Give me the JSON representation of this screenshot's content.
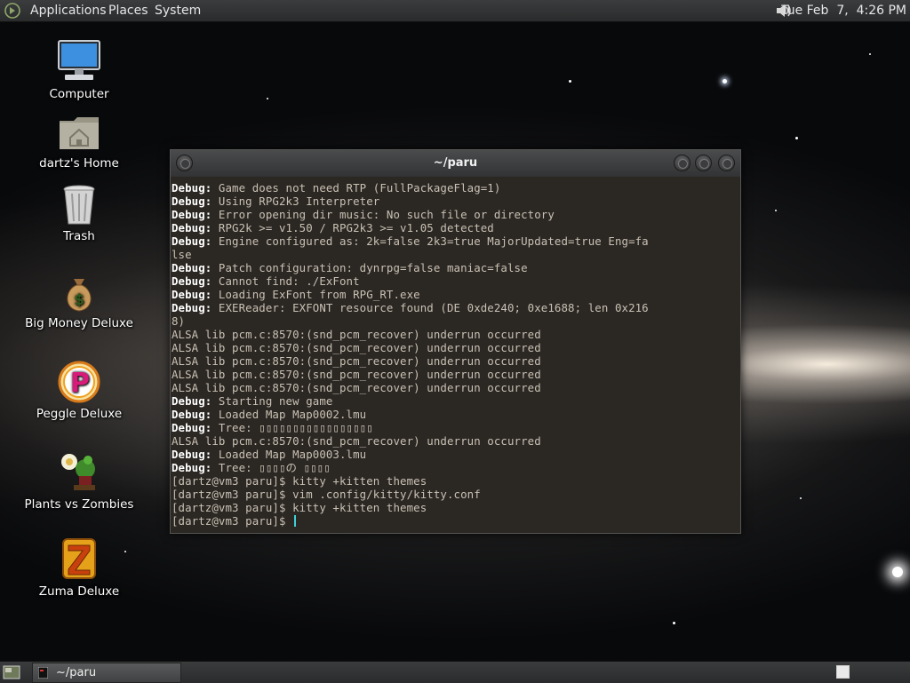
{
  "top_panel": {
    "menus": [
      "Applications",
      "Places",
      "System"
    ],
    "clock": "Tue Feb  7,  4:26 PM"
  },
  "desktop_icons": [
    {
      "label": "Computer",
      "icon": "computer-icon"
    },
    {
      "label": "dartz's Home",
      "icon": "home-folder-icon"
    },
    {
      "label": "Trash",
      "icon": "trash-icon"
    },
    {
      "label": "Big Money Deluxe",
      "icon": "money-bag-icon"
    },
    {
      "label": "Peggle Deluxe",
      "icon": "peggle-icon"
    },
    {
      "label": "Plants vs Zombies",
      "icon": "plants-vs-zombies-icon"
    },
    {
      "label": "Zuma Deluxe",
      "icon": "zuma-icon"
    }
  ],
  "terminal": {
    "title": "~/paru",
    "lines": [
      {
        "prefix": "Debug:",
        "text": " Game does not need RTP (FullPackageFlag=1)"
      },
      {
        "prefix": "Debug:",
        "text": " Using RPG2k3 Interpreter"
      },
      {
        "prefix": "Debug:",
        "text": " Error opening dir music: No such file or directory"
      },
      {
        "prefix": "Debug:",
        "text": " RPG2k >= v1.50 / RPG2k3 >= v1.05 detected"
      },
      {
        "prefix": "Debug:",
        "text": " Engine configured as: 2k=false 2k3=true MajorUpdated=true Eng=fa"
      },
      {
        "prefix": "",
        "text": "lse"
      },
      {
        "prefix": "Debug:",
        "text": " Patch configuration: dynrpg=false maniac=false"
      },
      {
        "prefix": "Debug:",
        "text": " Cannot find: ./ExFont"
      },
      {
        "prefix": "Debug:",
        "text": " Loading ExFont from RPG_RT.exe"
      },
      {
        "prefix": "Debug:",
        "text": " EXEReader: EXFONT resource found (DE 0xde240; 0xe1688; len 0x216"
      },
      {
        "prefix": "",
        "text": "8)"
      },
      {
        "prefix": "",
        "text": "ALSA lib pcm.c:8570:(snd_pcm_recover) underrun occurred"
      },
      {
        "prefix": "",
        "text": "ALSA lib pcm.c:8570:(snd_pcm_recover) underrun occurred"
      },
      {
        "prefix": "",
        "text": "ALSA lib pcm.c:8570:(snd_pcm_recover) underrun occurred"
      },
      {
        "prefix": "",
        "text": "ALSA lib pcm.c:8570:(snd_pcm_recover) underrun occurred"
      },
      {
        "prefix": "",
        "text": "ALSA lib pcm.c:8570:(snd_pcm_recover) underrun occurred"
      },
      {
        "prefix": "Debug:",
        "text": " Starting new game"
      },
      {
        "prefix": "Debug:",
        "text": " Loaded Map Map0002.lmu"
      },
      {
        "prefix": "Debug:",
        "text": " Tree: ▯▯▯▯▯▯▯▯▯▯▯▯▯▯▯▯▯"
      },
      {
        "prefix": "",
        "text": "ALSA lib pcm.c:8570:(snd_pcm_recover) underrun occurred"
      },
      {
        "prefix": "Debug:",
        "text": " Loaded Map Map0003.lmu"
      },
      {
        "prefix": "Debug:",
        "text": " Tree: ▯▯▯▯の ▯▯▯▯"
      },
      {
        "prefix": "",
        "text": "[dartz@vm3 paru]$ kitty +kitten themes"
      },
      {
        "prefix": "",
        "text": "[dartz@vm3 paru]$ vim .config/kitty/kitty.conf"
      },
      {
        "prefix": "",
        "text": "[dartz@vm3 paru]$ kitty +kitten themes"
      }
    ],
    "prompt": "[dartz@vm3 paru]$ "
  },
  "taskbar": {
    "window_label": "~/paru"
  }
}
